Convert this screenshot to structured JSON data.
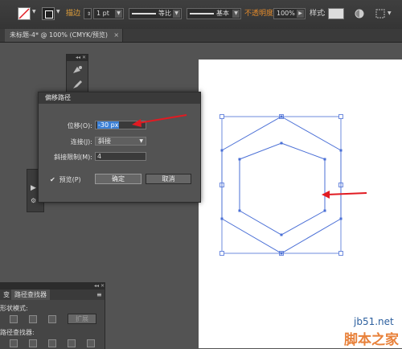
{
  "control_bar": {
    "stroke_label": "描边",
    "stroke_weight": "1 pt",
    "profile_label": "等比",
    "brush_label": "基本",
    "opacity_label": "不透明度",
    "opacity_value": "100%",
    "style_label": "样式"
  },
  "document_tab": {
    "title": "未标题-4* @ 100% (CMYK/预览)",
    "close": "×"
  },
  "dialog": {
    "title": "偏移路径",
    "offset_label": "位移(O):",
    "offset_value": "-30 px",
    "join_label": "连接(J):",
    "join_value": "斜接",
    "miter_label": "斜接限制(M):",
    "miter_value": "4",
    "preview_label": "预览(P)",
    "preview_checked": true,
    "ok_label": "确定",
    "cancel_label": "取消"
  },
  "pathfinder_panel": {
    "tab_transform": "变",
    "tab_pathfinder": "路径查找器",
    "shape_modes_label": "形状模式:",
    "pathfinders_label": "路径查找器:",
    "expand_label": "扩展"
  },
  "watermark": {
    "site": "jb51.net",
    "brand": "脚本之家"
  },
  "colors": {
    "accent_arrow": "#e11b22",
    "path_color": "#4a6fd6",
    "selection_highlight": "#3a7fd5",
    "watermark_orange": "#e8813a",
    "watermark_blue": "#2c5f9e"
  }
}
